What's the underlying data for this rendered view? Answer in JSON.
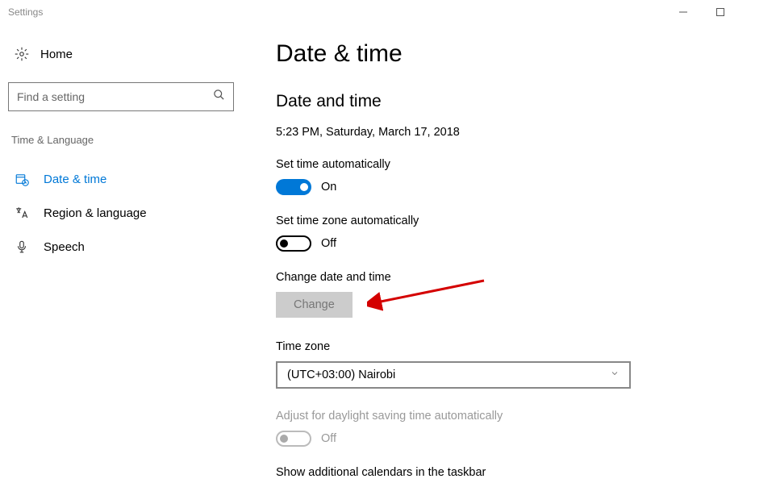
{
  "window": {
    "title": "Settings"
  },
  "sidebar": {
    "home_label": "Home",
    "search_placeholder": "Find a setting",
    "section_header": "Time & Language",
    "items": [
      {
        "label": "Date & time"
      },
      {
        "label": "Region & language"
      },
      {
        "label": "Speech"
      }
    ]
  },
  "main": {
    "page_title": "Date & time",
    "subheading": "Date and time",
    "datetime_display": "5:23 PM, Saturday, March 17, 2018",
    "auto_time_label": "Set time automatically",
    "auto_time_state": "On",
    "auto_tz_label": "Set time zone automatically",
    "auto_tz_state": "Off",
    "change_dt_label": "Change date and time",
    "change_button": "Change",
    "tz_label": "Time zone",
    "tz_value": "(UTC+03:00) Nairobi",
    "dst_label": "Adjust for daylight saving time automatically",
    "dst_state": "Off",
    "calendars_label": "Show additional calendars in the taskbar"
  }
}
